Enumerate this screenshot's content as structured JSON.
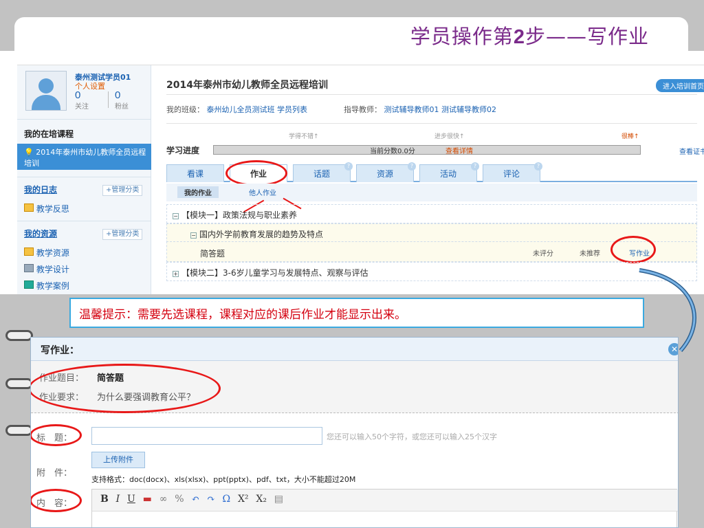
{
  "slide": {
    "title_prefix": "学员操作第",
    "title_num": "2",
    "title_suffix": "步——写作业"
  },
  "sidebar": {
    "user_name": "泰州测试学员01",
    "settings": "个人设置",
    "follow_count": "0",
    "follow_label": "关注",
    "fans_count": "0",
    "fans_label": "粉丝",
    "courses_heading": "我的在培课程",
    "course_item": "2014年泰州市幼儿教师全员远程培训",
    "log_heading": "我的日志",
    "log_manage": "+管理分类",
    "log_item": "教学反思",
    "res_heading": "我的资源",
    "res_manage": "+管理分类",
    "res_items": [
      "教学资源",
      "教学设计",
      "教学案例"
    ]
  },
  "main": {
    "course_title": "2014年泰州市幼儿教师全员远程培训",
    "enter_button": "进入培训首页",
    "class_label": "我的班级：",
    "class_name": "泰州幼儿全员测试班",
    "student_list": "学员列表",
    "tutor_label": "指导教师：",
    "tutor1": "测试辅导教师01",
    "tutor2": "测试辅导教师02",
    "progress_label": "学习进度",
    "milestone1": "学得不错↑",
    "milestone2": "进步很快↑",
    "milestone3": "很棒↑",
    "score_text": "当前分数0.0分",
    "detail_link": "查看详情",
    "view_cert": "查看证书",
    "tabs": [
      "看课",
      "作业",
      "话题",
      "资源",
      "活动",
      "评论"
    ],
    "subtab_mine": "我的作业",
    "subtab_others": "他人作业",
    "module1": "【模块一】政策法规与职业素养",
    "topic1": "国内外学前教育发展的趋势及特点",
    "question": "简答题",
    "status_score": "未评分",
    "status_rec": "未推荐",
    "write_link": "写作业",
    "module2": "【模块二】3-6岁儿童学习与发展特点、观察与评估"
  },
  "hint": "温馨提示：需要先选课程，课程对应的课后作业才能显示出来。",
  "dialog": {
    "title": "写作业：",
    "topic_label": "作业题目：",
    "topic_value": "简答题",
    "req_label": "作业要求：",
    "req_value": "为什么要强调教育公平？",
    "title_label": "标　题：",
    "title_hint": "您还可以输入50个字符，或您还可以输入25个汉字",
    "attach_label": "附　件：",
    "upload_button": "上传附件",
    "formats": "支持格式：doc(docx)、xls(xlsx)、ppt(pptx)、pdf、txt，大小不能超过20M",
    "content_label": "内　容："
  }
}
